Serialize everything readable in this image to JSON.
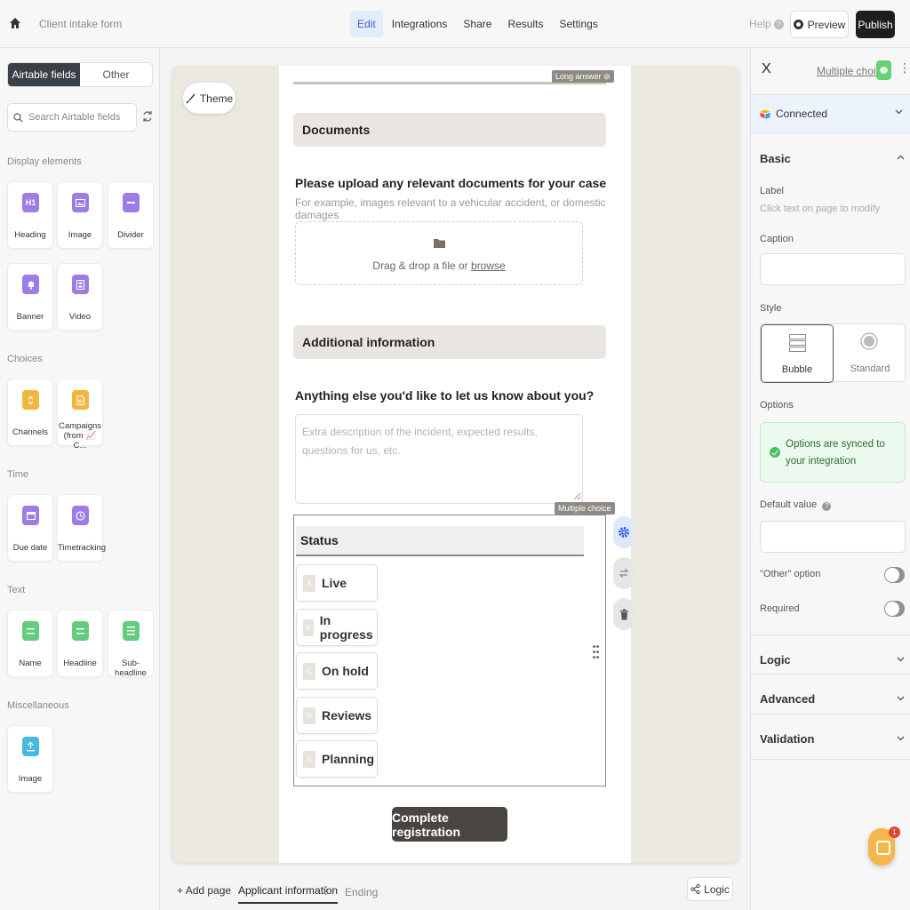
{
  "header": {
    "title": "Client intake form",
    "tabs": [
      {
        "label": "Edit"
      },
      {
        "label": "Integrations"
      },
      {
        "label": "Share"
      },
      {
        "label": "Results"
      },
      {
        "label": "Settings"
      }
    ],
    "help": "Help",
    "preview": "Preview",
    "publish": "Publish"
  },
  "sidebar": {
    "segments": [
      "Airtable fields",
      "Other"
    ],
    "search_placeholder": "Search Airtable fields",
    "sections": [
      {
        "label": "Display elements",
        "items": [
          {
            "label": "Heading",
            "icon": "heading-icon",
            "glyph": "H1"
          },
          {
            "label": "Image",
            "icon": "image-icon"
          },
          {
            "label": "Divider",
            "icon": "divider-icon"
          },
          {
            "label": "Banner",
            "icon": "bell-icon"
          },
          {
            "label": "Video",
            "icon": "video-icon"
          }
        ]
      },
      {
        "label": "Choices",
        "items": [
          {
            "label": "Channels",
            "icon": "select-icon"
          },
          {
            "label": "Campaigns (from 📈 C...",
            "icon": "linked-record-icon"
          }
        ]
      },
      {
        "label": "Time",
        "items": [
          {
            "label": "Due date",
            "icon": "calendar-icon"
          },
          {
            "label": "Timetracking",
            "icon": "clock-icon"
          }
        ]
      },
      {
        "label": "Text",
        "items": [
          {
            "label": "Name",
            "icon": "text-icon"
          },
          {
            "label": "Headline",
            "icon": "text-icon"
          },
          {
            "label": "Sub-headline",
            "icon": "long-text-icon"
          }
        ]
      },
      {
        "label": "Miscellaneous",
        "items": [
          {
            "label": "Image",
            "icon": "upload-icon"
          }
        ]
      }
    ]
  },
  "canvas": {
    "theme_button": "Theme",
    "long_answer_tag": "Long answer",
    "documents_heading": "Documents",
    "upload_question": "Please upload any relevant documents for your case",
    "upload_caption": "For example, images relevant to a vehicular accident, or domestic damages",
    "upload_text": "Drag & drop a file or ",
    "upload_link": "browse",
    "additional_heading": "Additional information",
    "anything_question": "Anything else you'd like to let us know about you?",
    "textarea_placeholder": "Extra description of the incident, expected results, questions for us, etc.",
    "multiple_choice_tag": "Multiple choice",
    "status_label": "Status",
    "options": [
      {
        "key": "A",
        "label": "Live"
      },
      {
        "key": "B",
        "label": "In progress"
      },
      {
        "key": "C",
        "label": "On hold"
      },
      {
        "key": "D",
        "label": "Reviews"
      },
      {
        "key": "E",
        "label": "Planning"
      }
    ],
    "submit_label": "Complete registration"
  },
  "footer": {
    "add_page": "Add page",
    "pages": [
      "Applicant information",
      "Ending"
    ],
    "logic": "Logic"
  },
  "panel": {
    "close": "X",
    "field_type": "Multiple choice",
    "connected": "Connected",
    "basic": "Basic",
    "label": "Label",
    "label_hint": "Click text on page to modify",
    "caption": "Caption",
    "style": "Style",
    "style_options": [
      "Bubble",
      "Standard"
    ],
    "options": "Options",
    "synced_text": "Options are synced to your integration",
    "default_value": "Default value",
    "other_option": "\"Other\" option",
    "required": "Required",
    "logic": "Logic",
    "advanced": "Advanced",
    "validation": "Validation",
    "chat_badge": "1"
  },
  "colors": {
    "accent_blue": "#3e63c9",
    "publish_bg": "#1e1e1e",
    "submit_bg": "#4a4540",
    "canvas_bg": "#ebe8e0",
    "synced_bg": "#ecf9ee"
  }
}
